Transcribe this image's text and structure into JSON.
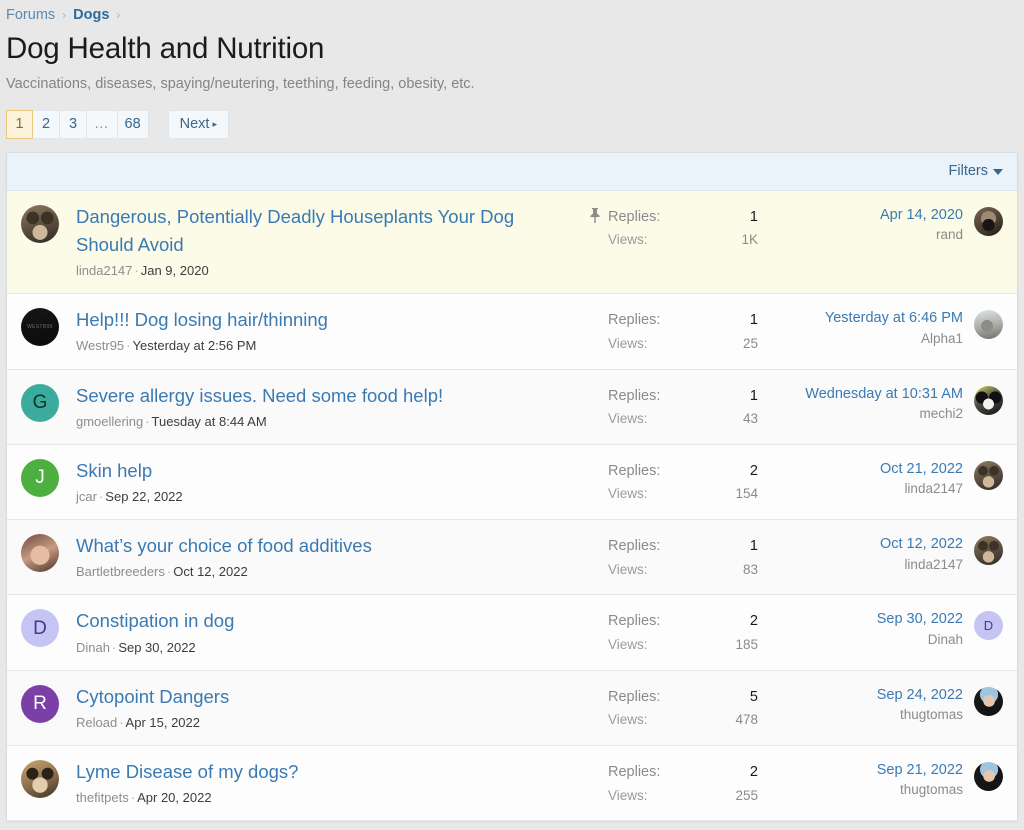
{
  "breadcrumb": {
    "items": [
      {
        "label": "Forums",
        "current": false
      },
      {
        "label": "Dogs",
        "current": true
      }
    ],
    "separator": "›"
  },
  "page": {
    "title": "Dog Health and Nutrition",
    "description": "Vaccinations, diseases, spaying/neutering, teething, feeding, obesity, etc."
  },
  "pagination": {
    "pages": [
      "1",
      "2",
      "3",
      "…",
      "68"
    ],
    "active_index": 0,
    "next_label": "Next",
    "next_arrow": "▸"
  },
  "filters": {
    "label": "Filters"
  },
  "labels": {
    "replies": "Replies:",
    "views": "Views:"
  },
  "colors": {
    "link": "#3a7ab3",
    "page_active_bg": "#fdf3dd",
    "page_active_border": "#e8c97c",
    "sticky_row_bg": "#fbfbe7",
    "filterbar_bg": "#eaf2fa"
  },
  "threads": [
    {
      "sticky": true,
      "pin_icon": "pin-icon",
      "title": "Dangerous, Potentially Deadly Houseplants Your Dog Should Avoid",
      "author": "linda2147",
      "date": "Jan 9, 2020",
      "replies": "1",
      "views": "1K",
      "last_date": "Apr 14, 2020",
      "last_user": "rand",
      "avatar": {
        "kind": "photo",
        "style": "photo-gsd",
        "letter": ""
      },
      "last_avatar": {
        "kind": "photo",
        "style": "photo-pug",
        "letter": ""
      }
    },
    {
      "sticky": false,
      "title": "Help!!! Dog losing hair/thinning",
      "author": "Westr95",
      "date": "Yesterday at 2:56 PM",
      "replies": "1",
      "views": "25",
      "last_date": "Yesterday at 6:46 PM",
      "last_user": "Alpha1",
      "avatar": {
        "kind": "photo",
        "style": "photo-black",
        "letter": ""
      },
      "last_avatar": {
        "kind": "photo",
        "style": "photo-wolf",
        "letter": ""
      }
    },
    {
      "sticky": false,
      "title": "Severe allergy issues. Need some food help!",
      "author": "gmoellering",
      "date": "Tuesday at 8:44 AM",
      "replies": "1",
      "views": "43",
      "last_date": "Wednesday at 10:31 AM",
      "last_user": "mechi2",
      "avatar": {
        "kind": "letter",
        "style": "av-teal",
        "letter": "G"
      },
      "last_avatar": {
        "kind": "photo",
        "style": "photo-bernese",
        "letter": ""
      }
    },
    {
      "sticky": false,
      "title": "Skin help",
      "author": "jcar",
      "date": "Sep 22, 2022",
      "replies": "2",
      "views": "154",
      "last_date": "Oct 21, 2022",
      "last_user": "linda2147",
      "avatar": {
        "kind": "letter",
        "style": "av-green",
        "letter": "J"
      },
      "last_avatar": {
        "kind": "photo",
        "style": "photo-gsd",
        "letter": ""
      }
    },
    {
      "sticky": false,
      "title": "What’s your choice of food additives",
      "author": "Bartletbreeders",
      "date": "Oct 12, 2022",
      "replies": "1",
      "views": "83",
      "last_date": "Oct 12, 2022",
      "last_user": "linda2147",
      "avatar": {
        "kind": "photo",
        "style": "photo-woman",
        "letter": ""
      },
      "last_avatar": {
        "kind": "photo",
        "style": "photo-gsd",
        "letter": ""
      }
    },
    {
      "sticky": false,
      "title": "Constipation in dog",
      "author": "Dinah",
      "date": "Sep 30, 2022",
      "replies": "2",
      "views": "185",
      "last_date": "Sep 30, 2022",
      "last_user": "Dinah",
      "avatar": {
        "kind": "letter",
        "style": "av-lavender",
        "letter": "D"
      },
      "last_avatar": {
        "kind": "letter",
        "style": "av-lavender",
        "letter": "D"
      }
    },
    {
      "sticky": false,
      "title": "Cytopoint Dangers",
      "author": "Reload",
      "date": "Apr 15, 2022",
      "replies": "5",
      "views": "478",
      "last_date": "Sep 24, 2022",
      "last_user": "thugtomas",
      "avatar": {
        "kind": "letter",
        "style": "av-purple",
        "letter": "R"
      },
      "last_avatar": {
        "kind": "photo",
        "style": "photo-man",
        "letter": ""
      }
    },
    {
      "sticky": false,
      "title": "Lyme Disease of my dogs?",
      "author": "thefitpets",
      "date": "Apr 20, 2022",
      "replies": "2",
      "views": "255",
      "last_date": "Sep 21, 2022",
      "last_user": "thugtomas",
      "avatar": {
        "kind": "photo",
        "style": "photo-shepherd2",
        "letter": ""
      },
      "last_avatar": {
        "kind": "photo",
        "style": "photo-man",
        "letter": ""
      }
    }
  ]
}
